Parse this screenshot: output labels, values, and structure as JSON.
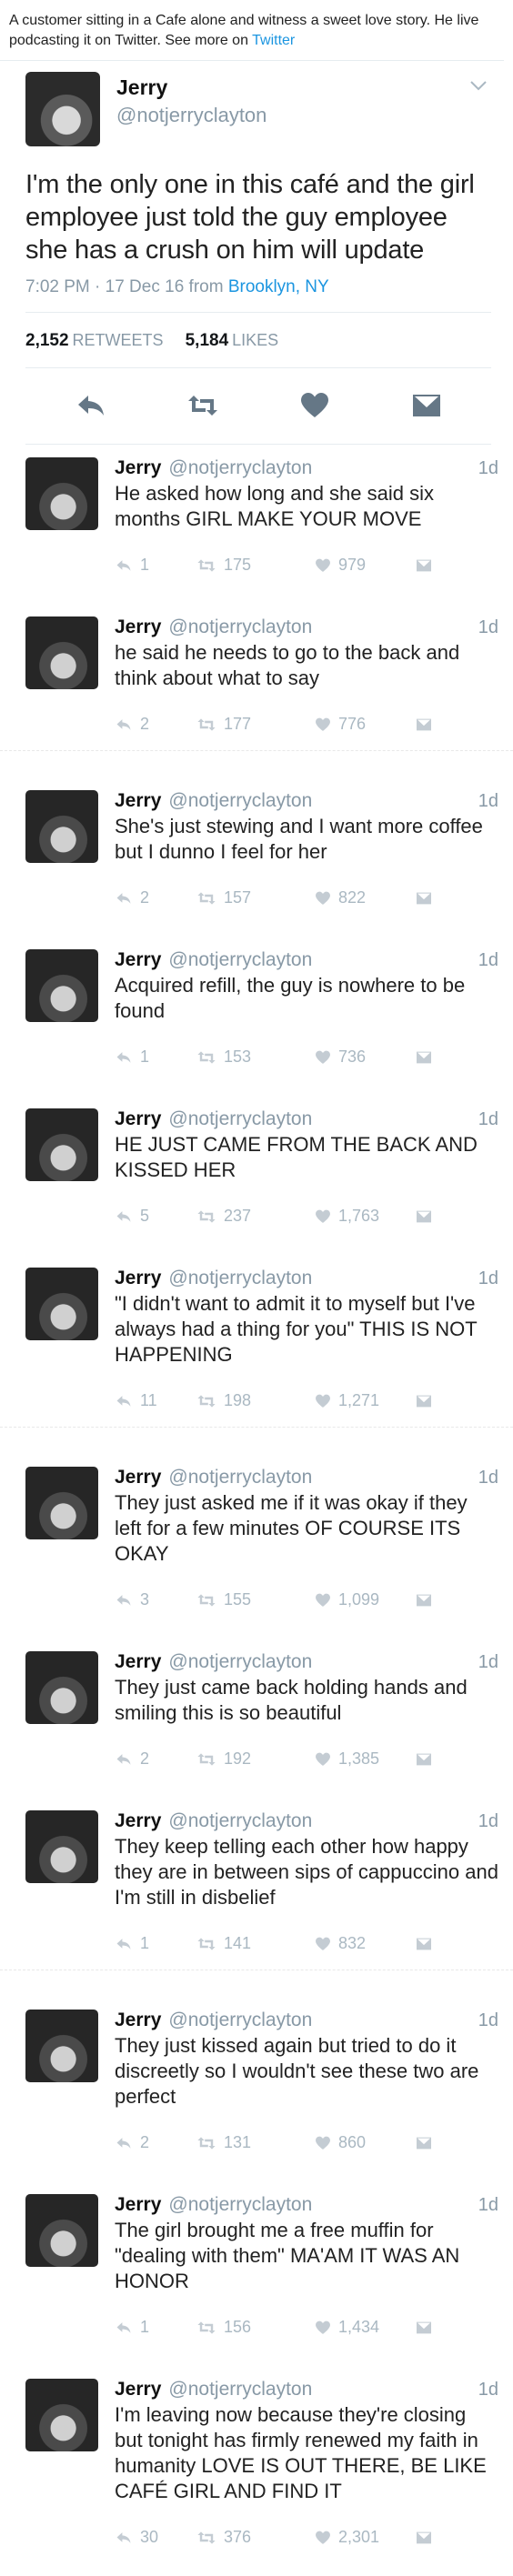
{
  "caption": {
    "text": "A customer sitting in a Cafe alone and witness a sweet love story. He live podcasting it on Twitter. See more on ",
    "link": "Twitter"
  },
  "main_tweet": {
    "name": "Jerry",
    "handle": "@notjerryclayton",
    "text": "I'm the only one in this café and the girl employee just told the guy employee she has a crush on him will update",
    "timestamp": "7:02 PM · 17 Dec 16 from ",
    "location": "Brooklyn, NY",
    "retweets": "2,152",
    "retweets_label": "RETWEETS",
    "likes": "5,184",
    "likes_label": "LIKES"
  },
  "icons": {
    "reply": "reply-arrow-icon",
    "retweet": "retweet-icon",
    "like": "heart-icon",
    "dm": "envelope-icon",
    "chevron": "chevron-down-icon"
  },
  "replies": [
    {
      "name": "Jerry",
      "handle": "@notjerryclayton",
      "time": "1d",
      "text": "He asked how long and she said six months GIRL MAKE YOUR MOVE",
      "replies": "1",
      "retweets": "175",
      "likes": "979"
    },
    {
      "name": "Jerry",
      "handle": "@notjerryclayton",
      "time": "1d",
      "text": "he said he needs to go to the back and think about what to say",
      "replies": "2",
      "retweets": "177",
      "likes": "776"
    },
    {
      "name": "Jerry",
      "handle": "@notjerryclayton",
      "time": "1d",
      "text": "She's just stewing and I want more coffee but I dunno I feel for her",
      "replies": "2",
      "retweets": "157",
      "likes": "822"
    },
    {
      "name": "Jerry",
      "handle": "@notjerryclayton",
      "time": "1d",
      "text": "Acquired refill, the guy is nowhere to be found",
      "replies": "1",
      "retweets": "153",
      "likes": "736"
    },
    {
      "name": "Jerry",
      "handle": "@notjerryclayton",
      "time": "1d",
      "text": "HE JUST CAME FROM THE BACK AND KISSED HER",
      "replies": "5",
      "retweets": "237",
      "likes": "1,763"
    },
    {
      "name": "Jerry",
      "handle": "@notjerryclayton",
      "time": "1d",
      "text": "\"I didn't want to admit it to myself but I've always had a thing for you\" THIS IS NOT HAPPENING",
      "replies": "11",
      "retweets": "198",
      "likes": "1,271"
    },
    {
      "name": "Jerry",
      "handle": "@notjerryclayton",
      "time": "1d",
      "text": "They just asked me if it was okay if they left for a few minutes OF COURSE ITS OKAY",
      "replies": "3",
      "retweets": "155",
      "likes": "1,099"
    },
    {
      "name": "Jerry",
      "handle": "@notjerryclayton",
      "time": "1d",
      "text": "They just came back holding hands and smiling this is so beautiful",
      "replies": "2",
      "retweets": "192",
      "likes": "1,385"
    },
    {
      "name": "Jerry",
      "handle": "@notjerryclayton",
      "time": "1d",
      "text": "They keep telling each other how happy they are in between sips of cappuccino and I'm still in disbelief",
      "replies": "1",
      "retweets": "141",
      "likes": "832"
    },
    {
      "name": "Jerry",
      "handle": "@notjerryclayton",
      "time": "1d",
      "text": "They just kissed again but tried to do it discreetly so I wouldn't see these two are perfect",
      "replies": "2",
      "retweets": "131",
      "likes": "860"
    },
    {
      "name": "Jerry",
      "handle": "@notjerryclayton",
      "time": "1d",
      "text": "The girl brought me a free muffin for \"dealing with them\" MA'AM IT WAS AN HONOR",
      "replies": "1",
      "retweets": "156",
      "likes": "1,434"
    },
    {
      "name": "Jerry",
      "handle": "@notjerryclayton",
      "time": "1d",
      "text": "I'm leaving now because they're closing but tonight has firmly renewed my faith in humanity LOVE IS OUT THERE, BE LIKE CAFÉ GIRL AND FIND IT",
      "replies": "30",
      "retweets": "376",
      "likes": "2,301"
    }
  ]
}
